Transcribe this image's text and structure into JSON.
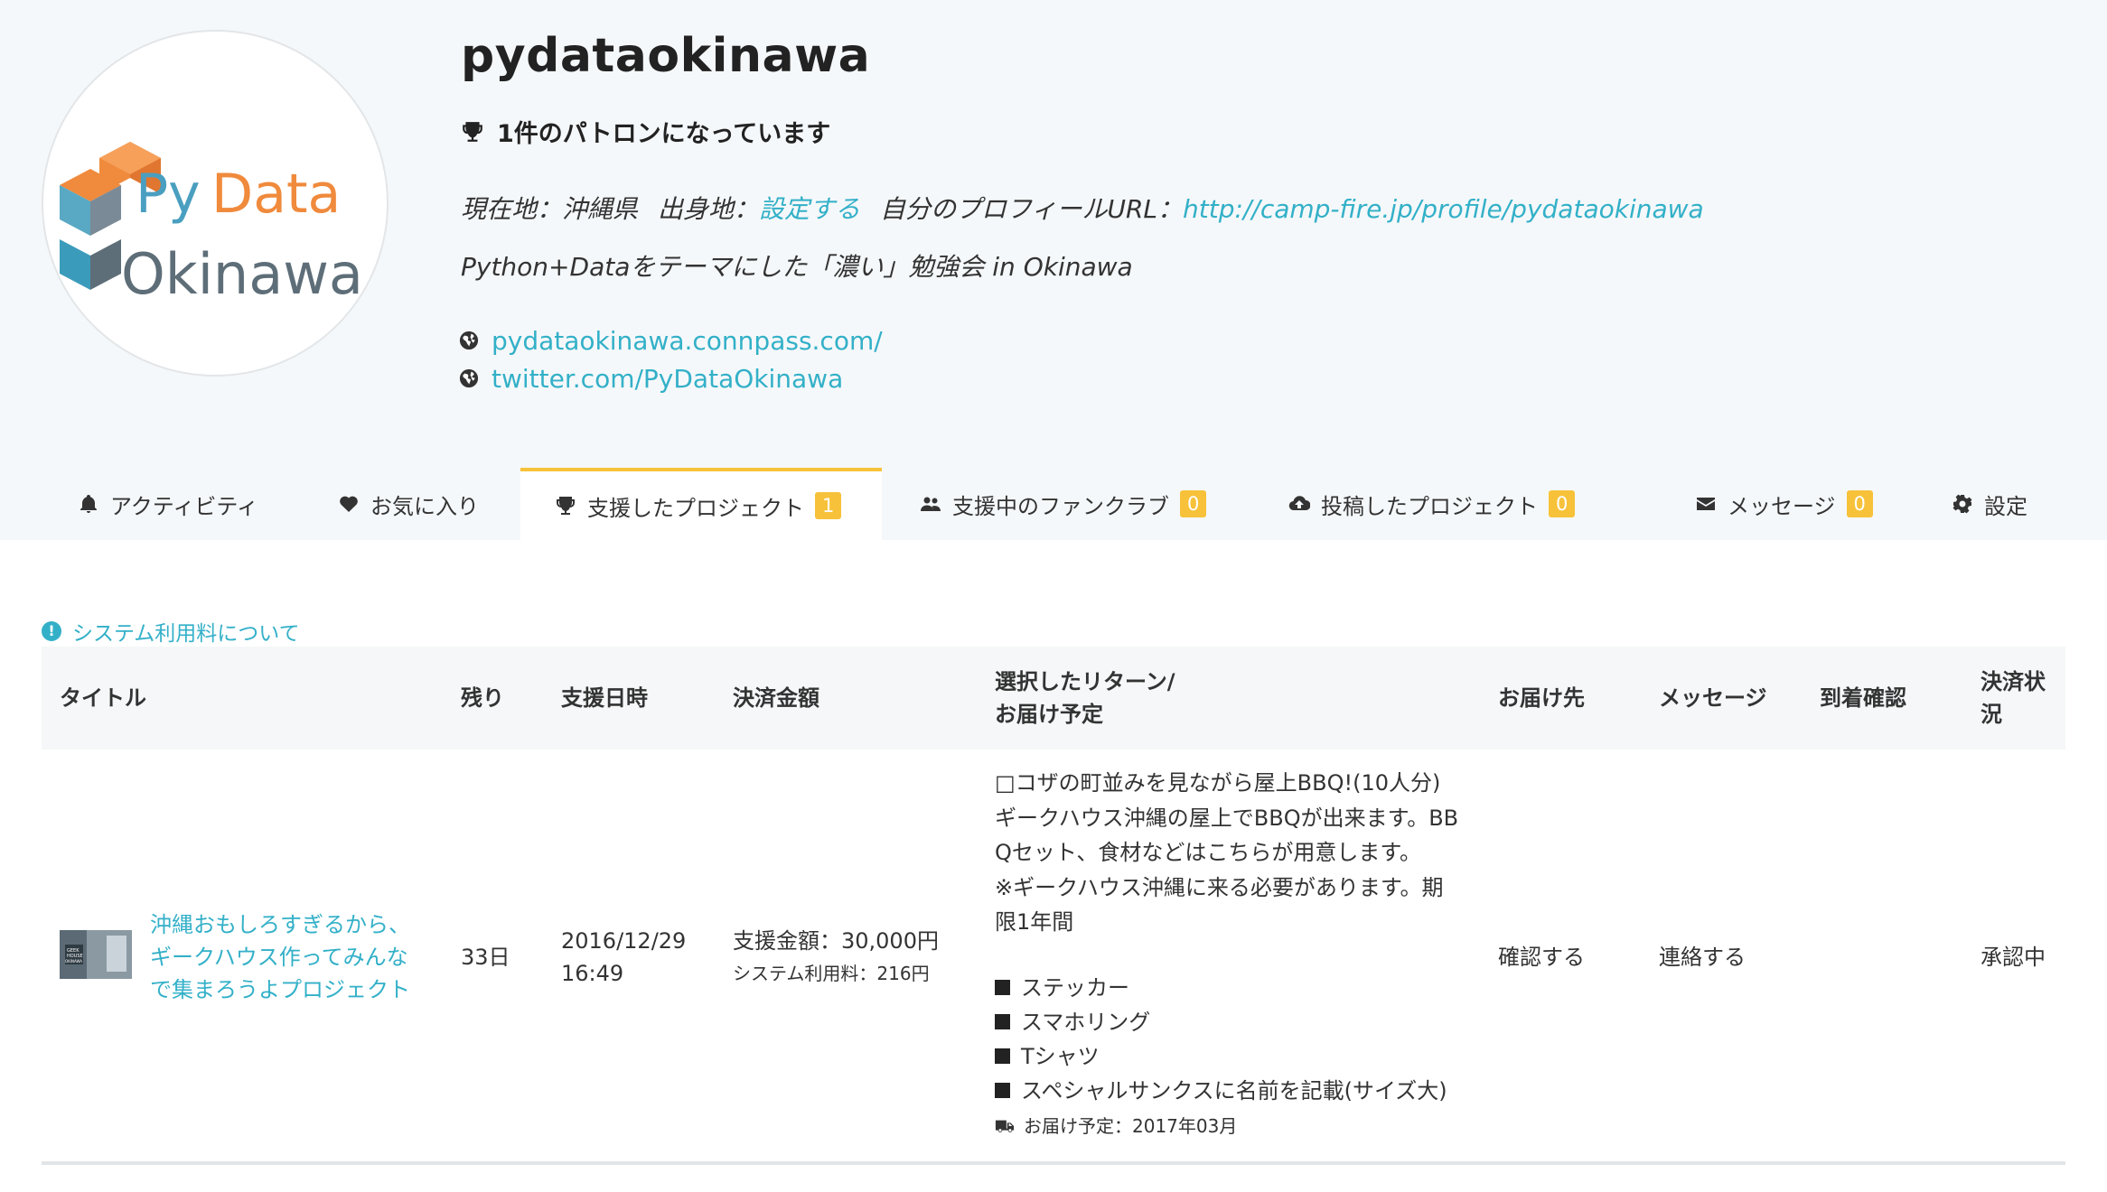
{
  "profile": {
    "name": "pydataokinawa",
    "patron_text": "1件のパトロンになっています",
    "location_label": "現在地：沖縄県",
    "hometown_label": "出身地：",
    "hometown_link": "設定する",
    "profile_url_label": "自分のプロフィールURL：",
    "profile_url": "http://camp-fire.jp/profile/pydataokinawa",
    "bio": "Python+Dataをテーマにした「濃い」勉強会 in Okinawa",
    "links": [
      "pydataokinawa.connpass.com/",
      "twitter.com/PyDataOkinawa"
    ],
    "logo": {
      "line1_a": "Py",
      "line1_b": "Data",
      "line2": "Okinawa"
    }
  },
  "tabs": [
    {
      "label": "アクティビティ",
      "icon": "bell-icon"
    },
    {
      "label": "お気に入り",
      "icon": "heart-icon"
    },
    {
      "label": "支援したプロジェクト",
      "icon": "trophy-icon",
      "badge": "1",
      "active": true
    },
    {
      "label": "支援中のファンクラブ",
      "icon": "users-icon",
      "badge": "0"
    },
    {
      "label": "投稿したプロジェクト",
      "icon": "cloud-upload-icon",
      "badge": "0"
    },
    {
      "label": "メッセージ",
      "icon": "envelope-icon",
      "badge": "0"
    },
    {
      "label": "設定",
      "icon": "gear-icon"
    }
  ],
  "fee_link": "システム利用料について",
  "table": {
    "headers": {
      "title": "タイトル",
      "remaining": "残り",
      "date": "支援日時",
      "amount": "決済金額",
      "return_1": "選択したリターン/",
      "return_2": "お届け予定",
      "delivery": "お届け先",
      "message": "メッセージ",
      "arrival": "到着確認",
      "status_1": "決済状",
      "status_2": "況"
    },
    "row": {
      "thumb_text": "GEEK HOUSE OKINAWA",
      "title_lines": [
        "沖縄おもしろすぎるから、",
        "ギークハウス作ってみんな",
        "で集まろうよプロジェクト"
      ],
      "remaining": "33日",
      "date": "2016/12/29",
      "time": "16:49",
      "amount": "支援金額：30,000円",
      "fee": "システム利用料：216円",
      "reward_lines": [
        "□コザの町並みを見ながら屋上BBQ!(10人分)",
        "ギークハウス沖縄の屋上でBBQが出来ます。BB",
        "Qセット、食材などはこちらが用意します。",
        "※ギークハウス沖縄に来る必要があります。期",
        "限1年間"
      ],
      "items": [
        "ステッカー",
        "スマホリング",
        "Tシャツ",
        "スペシャルサンクスに名前を記載(サイズ大)"
      ],
      "delivery_schedule": "お届け予定：2017年03月",
      "delivery_action": "確認する",
      "message_action": "連絡する",
      "status": "承認中"
    }
  },
  "colors": {
    "link": "#33b0c8",
    "badge": "#f7c23a",
    "header_bg": "#f5f8fa"
  }
}
